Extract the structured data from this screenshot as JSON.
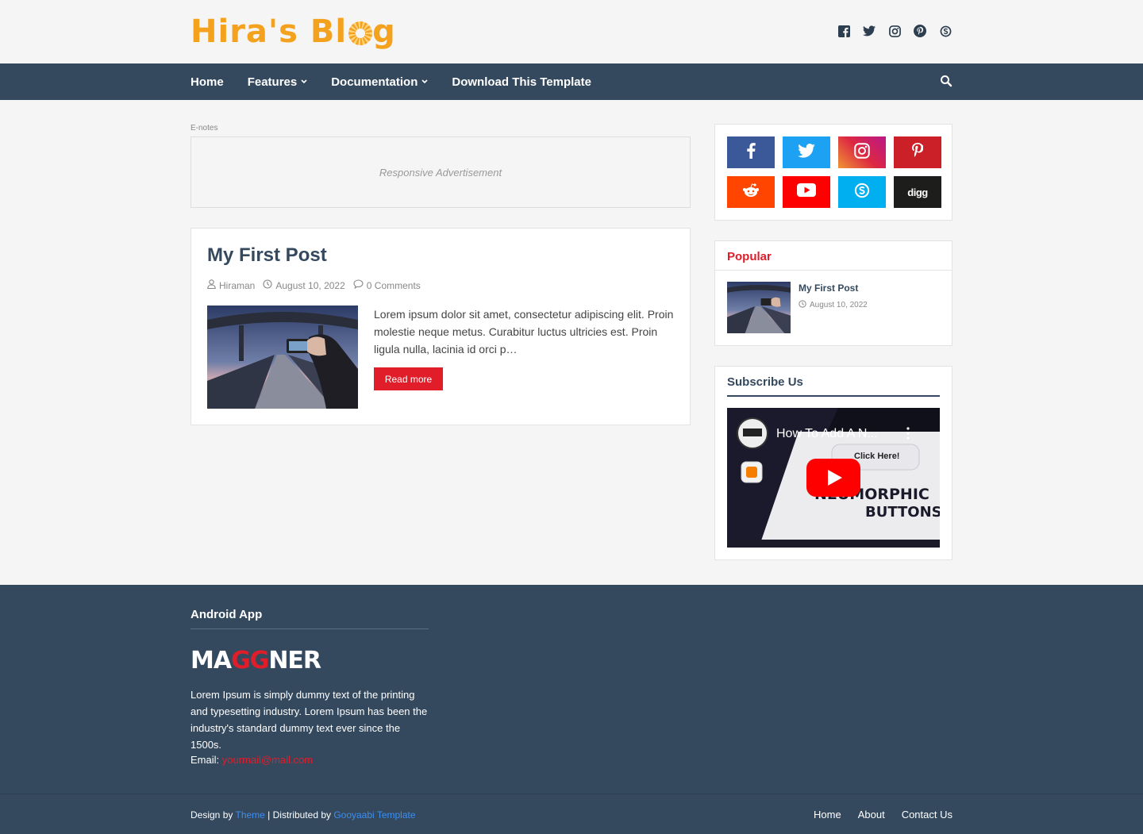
{
  "header": {
    "logo_text": "Hira's Bl",
    "logo_tail": "g",
    "social_icons": [
      "facebook-icon",
      "twitter-icon",
      "instagram-icon",
      "pinterest-icon",
      "skype-icon"
    ]
  },
  "nav": {
    "items": [
      {
        "label": "Home",
        "has_dropdown": false
      },
      {
        "label": "Features",
        "has_dropdown": true
      },
      {
        "label": "Documentation",
        "has_dropdown": true
      },
      {
        "label": "Download This Template",
        "has_dropdown": false
      }
    ]
  },
  "main": {
    "ad_label": "E-notes",
    "ad_text": "Responsive Advertisement",
    "post": {
      "title": "My First Post",
      "author": "Hiraman",
      "date": "August 10, 2022",
      "comments": "0 Comments",
      "excerpt": "Lorem ipsum dolor sit amet, consectetur adipiscing elit. Proin molestie neque metus. Curabitur luctus ultricies est. Proin ligula nulla, lacinia id orci p…",
      "read_more": "Read more"
    }
  },
  "sidebar": {
    "social_buttons": [
      {
        "name": "facebook",
        "glyph": "f",
        "color": "#3b5998"
      },
      {
        "name": "twitter",
        "glyph": "🐦",
        "color": "#1da1f2"
      },
      {
        "name": "instagram",
        "glyph": "◎",
        "color": "#c13584"
      },
      {
        "name": "pinterest",
        "glyph": "P",
        "color": "#cb2027"
      },
      {
        "name": "reddit",
        "glyph": "👽",
        "color": "#ff4500"
      },
      {
        "name": "youtube",
        "glyph": "▶",
        "color": "#ff0000"
      },
      {
        "name": "skype",
        "glyph": "S",
        "color": "#00aff0"
      },
      {
        "name": "digg",
        "glyph": "digg",
        "color": "#1d1d1b"
      }
    ],
    "popular": {
      "title": "Popular",
      "post_title": "My First Post",
      "post_date": "August 10, 2022"
    },
    "subscribe": {
      "title": "Subscribe Us",
      "video_title": "How To Add A N...",
      "video_text_1": "NEUMORPHIC",
      "video_text_2": "BUTTONS",
      "video_click": "Click Here!"
    }
  },
  "footer": {
    "title": "Android App",
    "logo_a": "MA",
    "logo_b": "GG",
    "logo_c": "NER",
    "desc": "Lorem Ipsum is simply dummy text of the printing and typesetting industry. Lorem Ipsum has been the industry's standard dummy text ever since the 1500s.",
    "email_label": "Email: ",
    "email": "yourmail@mail.com",
    "credit_1": "Design by ",
    "credit_theme": "Theme",
    "credit_2": " | Distributed by ",
    "credit_dist": "Gooyaabi Template",
    "links": [
      "Home",
      "About",
      "Contact Us"
    ]
  },
  "colors": {
    "accent": "#e11d2a",
    "nav_bg": "#34495e",
    "logo": "#f4a11d"
  }
}
